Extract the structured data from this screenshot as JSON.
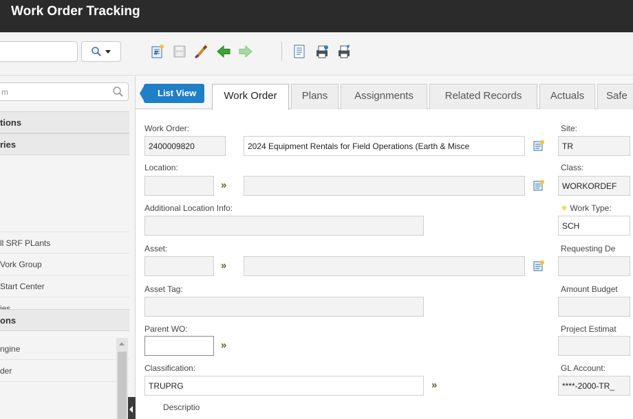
{
  "app": {
    "title": "Work Order Tracking"
  },
  "toolbar": {
    "search_value": "",
    "icons": [
      "magnifier-icon",
      "new-work-order-icon",
      "save-icon",
      "clear-changes-icon",
      "previous-record-icon",
      "next-record-icon",
      "view-history-icon",
      "print-icon",
      "print-setup-icon"
    ]
  },
  "nav": {
    "search_placeholder": "m",
    "sections": [
      "tions",
      "ries",
      "ons"
    ],
    "items": [
      "ll SRF PLants",
      "Vork Group",
      "Start Center",
      "ies",
      "ngine",
      "der"
    ]
  },
  "tabs": {
    "list_view": "List View",
    "items": [
      "Work Order",
      "Plans",
      "Assignments",
      "Related Records",
      "Actuals",
      "Safe"
    ]
  },
  "form": {
    "work_order_label": "Work Order:",
    "work_order_value": "2400009820",
    "description_value": "2024 Equipment Rentals for Field Operations (Earth & Misce",
    "location_label": "Location:",
    "additional_location_label": "Additional Location Info:",
    "asset_label": "Asset:",
    "asset_tag_label": "Asset Tag:",
    "parent_wo_label": "Parent WO:",
    "classification_label": "Classification:",
    "classification_value": "TRUPRG",
    "long_description_label": "Descriptio",
    "site_label": "Site:",
    "site_value": "TR",
    "class_label": "Class:",
    "class_value": "WORKORDEF",
    "work_type_label": "Work Type:",
    "work_type_value": "SCH",
    "requesting_label": "Requesting De",
    "amount_budget_label": "Amount Budget",
    "project_estimate_label": "Project Estimat",
    "gl_account_label": "GL Account:",
    "gl_account_value": "****-2000-TR_"
  },
  "colors": {
    "titlebar": "#2b2b2b",
    "accent": "#1f7fc7",
    "chevron": "#6b5a17",
    "required": "#f0b400"
  }
}
